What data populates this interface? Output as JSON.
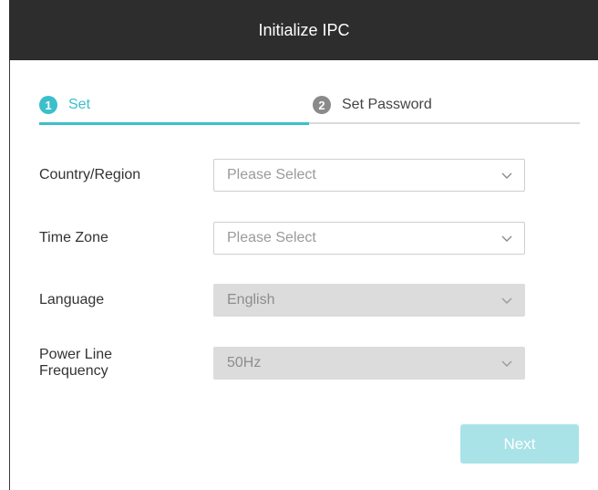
{
  "dialog": {
    "title": "Initialize IPC"
  },
  "steps": [
    {
      "number": "1",
      "label": "Set",
      "active": true
    },
    {
      "number": "2",
      "label": "Set Password",
      "active": false
    }
  ],
  "form": {
    "country": {
      "label": "Country/Region",
      "value": "Please Select",
      "disabled": false
    },
    "timezone": {
      "label": "Time Zone",
      "value": "Please Select",
      "disabled": false
    },
    "language": {
      "label": "Language",
      "value": "English",
      "disabled": true
    },
    "power": {
      "label_line1": "Power Line",
      "label_line2": "Frequency",
      "value": "50Hz",
      "disabled": true
    }
  },
  "actions": {
    "next_label": "Next"
  },
  "colors": {
    "accent": "#3bbfcb",
    "title_bar": "#2d2d2e",
    "button_disabled": "#a9e3e8"
  },
  "icons": {
    "dropdown": "chevron-down-icon"
  }
}
